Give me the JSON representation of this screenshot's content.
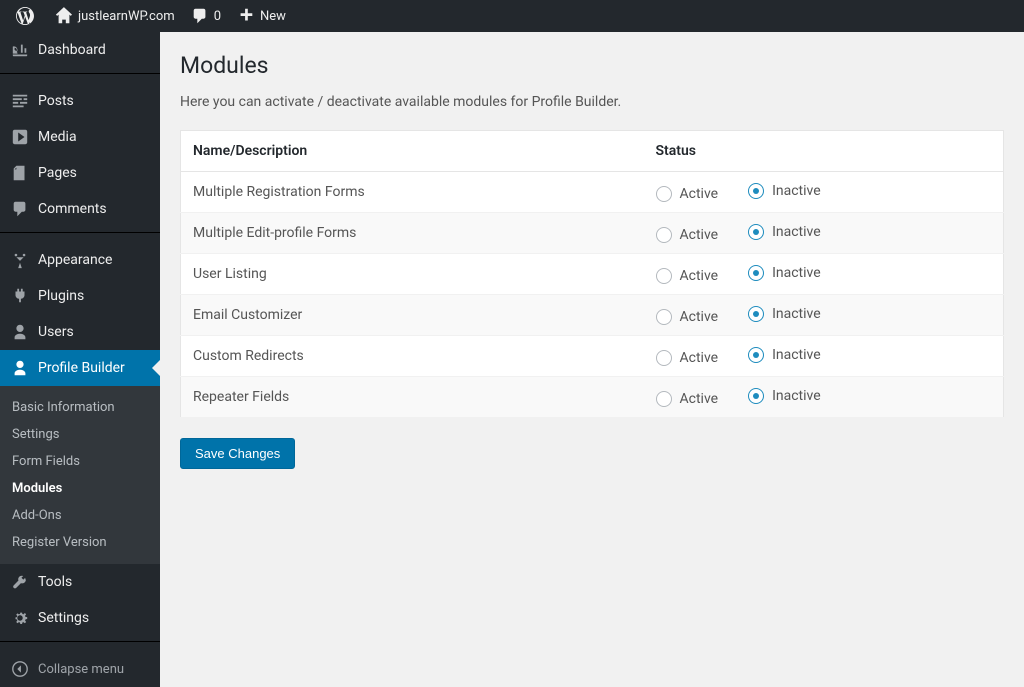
{
  "toolbar": {
    "site_name": "justlearnWP.com",
    "comments_count": "0",
    "new_label": "New"
  },
  "sidebar": {
    "items": [
      {
        "label": "Dashboard",
        "icon": "dashboard"
      },
      {
        "label": "Posts",
        "icon": "posts"
      },
      {
        "label": "Media",
        "icon": "media"
      },
      {
        "label": "Pages",
        "icon": "pages"
      },
      {
        "label": "Comments",
        "icon": "comments"
      },
      {
        "label": "Appearance",
        "icon": "appearance"
      },
      {
        "label": "Plugins",
        "icon": "plugins"
      },
      {
        "label": "Users",
        "icon": "users"
      },
      {
        "label": "Profile Builder",
        "icon": "users"
      },
      {
        "label": "Tools",
        "icon": "tools"
      },
      {
        "label": "Settings",
        "icon": "settings"
      }
    ],
    "submenu": [
      {
        "label": "Basic Information"
      },
      {
        "label": "Settings"
      },
      {
        "label": "Form Fields"
      },
      {
        "label": "Modules"
      },
      {
        "label": "Add-Ons"
      },
      {
        "label": "Register Version"
      }
    ],
    "collapse_label": "Collapse menu"
  },
  "page": {
    "title": "Modules",
    "description": "Here you can activate / deactivate available modules for Profile Builder."
  },
  "table": {
    "headers": {
      "name": "Name/Description",
      "status": "Status"
    },
    "status_labels": {
      "active": "Active",
      "inactive": "Inactive"
    },
    "rows": [
      {
        "name": "Multiple Registration Forms",
        "status": "inactive"
      },
      {
        "name": "Multiple Edit-profile Forms",
        "status": "inactive"
      },
      {
        "name": "User Listing",
        "status": "inactive"
      },
      {
        "name": "Email Customizer",
        "status": "inactive"
      },
      {
        "name": "Custom Redirects",
        "status": "inactive"
      },
      {
        "name": "Repeater Fields",
        "status": "inactive"
      }
    ]
  },
  "buttons": {
    "save": "Save Changes"
  }
}
